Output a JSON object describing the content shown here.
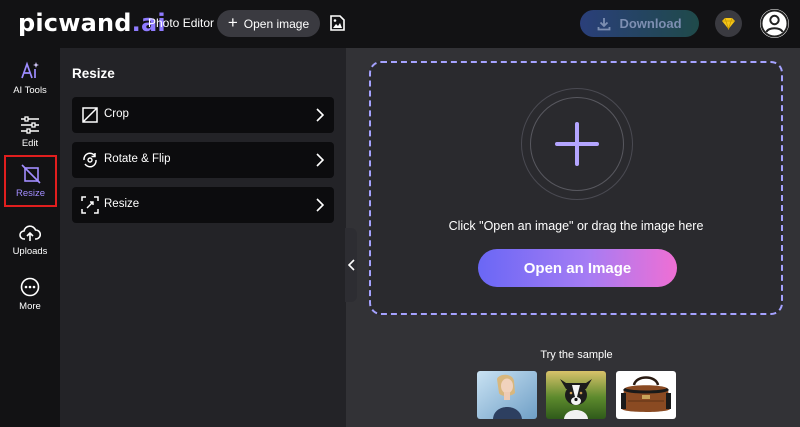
{
  "header": {
    "logo_text": "picwand",
    "logo_suffix": ".ai",
    "app_title": "Photo Editor",
    "open_image_label": "Open image",
    "download_label": "Download",
    "accent": "#8f7bff"
  },
  "nav": {
    "items": [
      {
        "label": "AI Tools",
        "icon": "ai-tools-icon"
      },
      {
        "label": "Edit",
        "icon": "sliders-icon"
      },
      {
        "label": "Resize",
        "icon": "resize-icon",
        "active": true
      },
      {
        "label": "Uploads",
        "icon": "cloud-upload-icon"
      },
      {
        "label": "More",
        "icon": "more-icon"
      }
    ]
  },
  "panel": {
    "title": "Resize",
    "tools": [
      {
        "label": "Crop",
        "icon": "crop-icon"
      },
      {
        "label": "Rotate & Flip",
        "icon": "rotate-icon"
      },
      {
        "label": "Resize",
        "icon": "resize-frame-icon"
      }
    ]
  },
  "main": {
    "drop_text": "Click \"Open an image\" or drag the image here",
    "open_button_label": "Open an Image",
    "sample_title": "Try the sample",
    "samples": [
      "woman-photo",
      "dog-photo",
      "bag-photo"
    ]
  }
}
